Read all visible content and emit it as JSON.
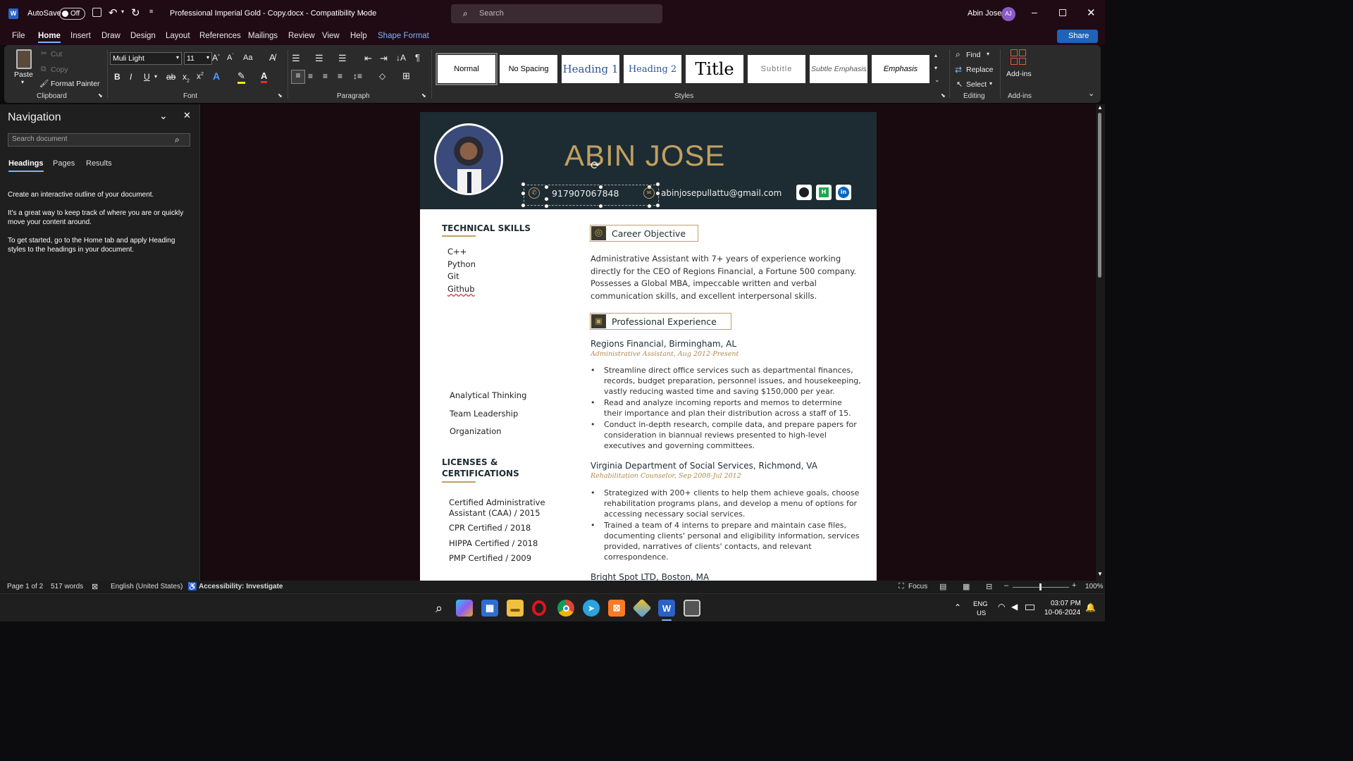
{
  "titlebar": {
    "autosave_label": "AutoSave",
    "autosave_state": "Off",
    "doc_title": "Professional Imperial Gold - Copy.docx  -  Compatibility Mode",
    "search_placeholder": "Search",
    "user_name": "Abin Jose",
    "user_initials": "AJ"
  },
  "tabs": [
    "File",
    "Home",
    "Insert",
    "Draw",
    "Design",
    "Layout",
    "References",
    "Mailings",
    "Review",
    "View",
    "Help",
    "Shape Format"
  ],
  "share_label": "Share",
  "clipboard": {
    "paste": "Paste",
    "cut": "Cut",
    "copy": "Copy",
    "format_painter": "Format Painter",
    "label": "Clipboard"
  },
  "font": {
    "name": "Muli Light",
    "size": "11",
    "label": "Font",
    "case": "Aa"
  },
  "paragraph": {
    "label": "Paragraph"
  },
  "styles": {
    "items": [
      "Normal",
      "No Spacing",
      "Heading 1",
      "Heading 2",
      "Title",
      "Subtitle",
      "Subtle Emphasis",
      "Emphasis"
    ],
    "label": "Styles"
  },
  "editing": {
    "find": "Find",
    "replace": "Replace",
    "select": "Select",
    "label": "Editing"
  },
  "addins": {
    "button": "Add-ins",
    "label": "Add-ins"
  },
  "navigation": {
    "title": "Navigation",
    "search_placeholder": "Search document",
    "tabs": [
      "Headings",
      "Pages",
      "Results"
    ],
    "p1": "Create an interactive outline of your document.",
    "p2": "It's a great way to keep track of where you are or quickly move your content around.",
    "p3": "To get started, go to the Home tab and apply Heading styles to the headings in your document."
  },
  "resume": {
    "name": "ABIN JOSE",
    "phone": "917907067848",
    "email": "abinjosepullattu@gmail.com",
    "tech_title": "TECHNICAL SKILLS",
    "tech_skills": [
      "C++",
      "Python",
      "Git",
      "Github"
    ],
    "soft_skills": [
      "Analytical Thinking",
      "Team Leadership",
      "Organization"
    ],
    "lic_title_1": "LICENSES &",
    "lic_title_2": "CERTIFICATIONS",
    "certs": [
      "Certified Administrative Assistant (CAA) / 2015",
      "CPR Certified / 2018",
      "HIPPA Certified / 2018",
      "PMP Certified / 2009"
    ],
    "career_title": "Career Objective",
    "career_text": "Administrative Assistant with 7+ years of experience working directly for the CEO of Regions Financial, a Fortune 500 company. Possesses a Global MBA, impeccable written and verbal communication skills, and excellent interpersonal skills.",
    "exp_title": "Professional Experience",
    "jobs": [
      {
        "company": "Regions Financial, Birmingham, AL",
        "role": "Administrative Assistant, Aug 2012-Present",
        "bullets": [
          "Streamline direct office services such as departmental finances, records, budget preparation, personnel issues, and housekeeping, vastly reducing wasted time and saving $150,000 per year.",
          "Read and analyze incoming reports and memos to determine their importance and plan their distribution across a staff of 15.",
          "Conduct in-depth research, compile data, and prepare papers for consideration in biannual reviews presented to high-level executives and governing committees."
        ]
      },
      {
        "company": "Virginia Department of Social Services, Richmond, VA",
        "role": "Rehabilitation Counselor, Sep 2008-Jul 2012",
        "bullets": [
          "Strategized with 200+ clients to help them achieve goals, choose rehabilitation programs plans, and develop a menu of options for accessing necessary social services.",
          "Trained a team of 4 interns to prepare and maintain case files, documenting clients' personal and eligibility information, services provided, narratives of clients' contacts, and relevant correspondence."
        ]
      },
      {
        "company": "Bright Spot LTD, Boston, MA"
      }
    ]
  },
  "status": {
    "page": "Page 1 of 2",
    "words": "517 words",
    "language": "English (United States)",
    "accessibility": "Accessibility: Investigate",
    "focus": "Focus",
    "zoom": "100%"
  },
  "tray": {
    "lang1": "ENG",
    "lang2": "US",
    "time": "03:07 PM",
    "date": "10-06-2024"
  },
  "colors": {
    "accent": "#c0a060",
    "header_bg": "#1d2b33",
    "word_blue": "#7ab6ff"
  }
}
